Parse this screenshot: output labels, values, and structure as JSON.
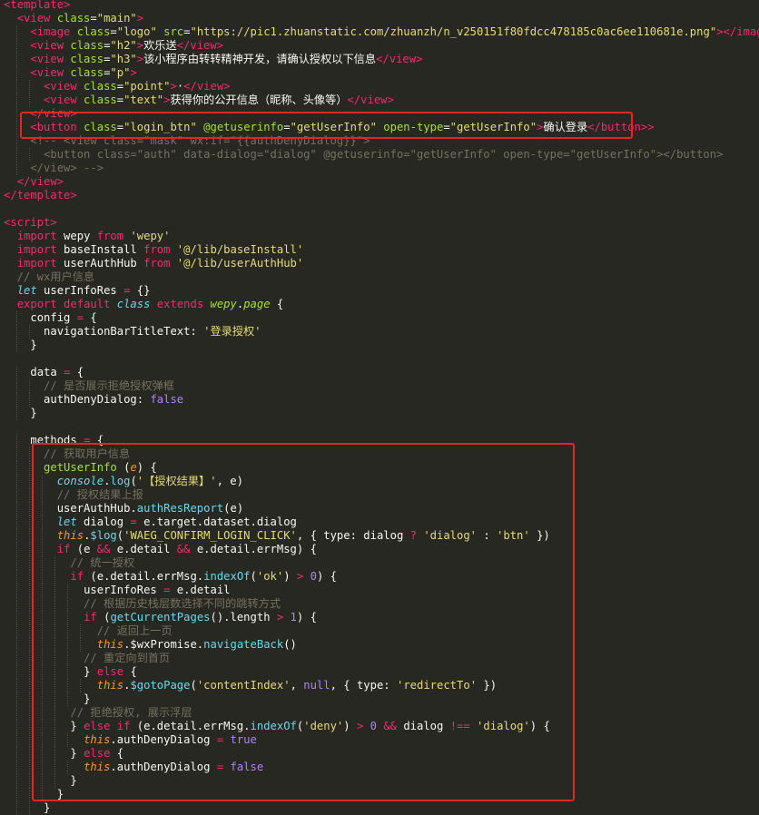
{
  "editor": {
    "language": "wepy",
    "lines": [
      [
        [
          "tag",
          "<template>"
        ]
      ],
      [
        [
          "txt",
          "  "
        ],
        [
          "tag",
          "<view"
        ],
        [
          "attr",
          " class"
        ],
        [
          "txt",
          "="
        ],
        [
          "str",
          "\"main\""
        ],
        [
          "tag",
          ">"
        ]
      ],
      [
        [
          "txt",
          "    "
        ],
        [
          "tag",
          "<image"
        ],
        [
          "attr",
          " class"
        ],
        [
          "txt",
          "="
        ],
        [
          "str",
          "\"logo\""
        ],
        [
          "attr",
          " src"
        ],
        [
          "txt",
          "="
        ],
        [
          "str",
          "\"https://pic1.zhuanstatic.com/zhuanzh/n_v250151f80fdcc478185c0ac6ee110681e.png\""
        ],
        [
          "tag",
          ">"
        ],
        [
          "tag",
          "</image>"
        ]
      ],
      [
        [
          "txt",
          "    "
        ],
        [
          "tag",
          "<view"
        ],
        [
          "attr",
          " class"
        ],
        [
          "txt",
          "="
        ],
        [
          "str",
          "\"h2\""
        ],
        [
          "tag",
          ">"
        ],
        [
          "txt",
          "欢乐送"
        ],
        [
          "tag",
          "</view>"
        ]
      ],
      [
        [
          "txt",
          "    "
        ],
        [
          "tag",
          "<view"
        ],
        [
          "attr",
          " class"
        ],
        [
          "txt",
          "="
        ],
        [
          "str",
          "\"h3\""
        ],
        [
          "tag",
          ">"
        ],
        [
          "txt",
          "该小程序由转转精神开发，请确认授权以下信息"
        ],
        [
          "tag",
          "</view>"
        ]
      ],
      [
        [
          "txt",
          "    "
        ],
        [
          "tag",
          "<view"
        ],
        [
          "attr",
          " class"
        ],
        [
          "txt",
          "="
        ],
        [
          "str",
          "\"p\""
        ],
        [
          "tag",
          ">"
        ]
      ],
      [
        [
          "txt",
          "      "
        ],
        [
          "tag",
          "<view"
        ],
        [
          "attr",
          " class"
        ],
        [
          "txt",
          "="
        ],
        [
          "str",
          "\"point\""
        ],
        [
          "tag",
          ">"
        ],
        [
          "txt",
          "·"
        ],
        [
          "tag",
          "</view>"
        ]
      ],
      [
        [
          "txt",
          "      "
        ],
        [
          "tag",
          "<view"
        ],
        [
          "attr",
          " class"
        ],
        [
          "txt",
          "="
        ],
        [
          "str",
          "\"text\""
        ],
        [
          "tag",
          ">"
        ],
        [
          "txt",
          "获得你的公开信息（昵称、头像等）"
        ],
        [
          "tag",
          "</view>"
        ]
      ],
      [
        [
          "txt",
          "    "
        ],
        [
          "tag",
          "</view>"
        ]
      ],
      [
        [
          "txt",
          "    "
        ],
        [
          "tag",
          "<button"
        ],
        [
          "attr",
          " class"
        ],
        [
          "txt",
          "="
        ],
        [
          "str",
          "\"login_btn\""
        ],
        [
          "attr",
          " @getuserinfo"
        ],
        [
          "txt",
          "="
        ],
        [
          "str",
          "\"getUserInfo\""
        ],
        [
          "attr",
          " open-type"
        ],
        [
          "txt",
          "="
        ],
        [
          "str",
          "\"getUserInfo\""
        ],
        [
          "tag",
          ">"
        ],
        [
          "txt",
          "确认登录"
        ],
        [
          "tag",
          "</button>"
        ],
        [
          "tag",
          ">"
        ]
      ],
      [
        [
          "cm",
          "    <!-- <view class=\"mask\" wx:if=\"{{authDenyDialog}}\">"
        ]
      ],
      [
        [
          "cm",
          "      <button class=\"auth\" data-dialog=\"dialog\" @getuserinfo=\"getUserInfo\" open-type=\"getUserInfo\"></button>"
        ]
      ],
      [
        [
          "cm",
          "    </view> -->"
        ]
      ],
      [
        [
          "txt",
          "  "
        ],
        [
          "tag",
          "</view>"
        ]
      ],
      [
        [
          "tag",
          "</template>"
        ]
      ],
      [
        [
          "txt",
          ""
        ]
      ],
      [
        [
          "tag",
          "<script>"
        ]
      ],
      [
        [
          "txt",
          "  "
        ],
        [
          "kw",
          "import"
        ],
        [
          "var",
          " wepy "
        ],
        [
          "kw",
          "from"
        ],
        [
          "str",
          " 'wepy'"
        ]
      ],
      [
        [
          "txt",
          "  "
        ],
        [
          "kw",
          "import"
        ],
        [
          "var",
          " baseInstall "
        ],
        [
          "kw",
          "from"
        ],
        [
          "str",
          " '@/lib/baseInstall'"
        ]
      ],
      [
        [
          "txt",
          "  "
        ],
        [
          "kw",
          "import"
        ],
        [
          "var",
          " userAuthHub "
        ],
        [
          "kw",
          "from"
        ],
        [
          "str",
          " '@/lib/userAuthHub'"
        ]
      ],
      [
        [
          "cm",
          "  // wx用户信息"
        ]
      ],
      [
        [
          "txt",
          "  "
        ],
        [
          "kwi",
          "let"
        ],
        [
          "var",
          " userInfoRes "
        ],
        [
          "op",
          "="
        ],
        [
          "var",
          " {}"
        ]
      ],
      [
        [
          "txt",
          "  "
        ],
        [
          "kw",
          "export"
        ],
        [
          "kw",
          " default"
        ],
        [
          "kwi",
          " class"
        ],
        [
          "kw",
          " extends"
        ],
        [
          "cls",
          " wepy"
        ],
        [
          "var",
          "."
        ],
        [
          "cls",
          "page"
        ],
        [
          "var",
          " {"
        ]
      ],
      [
        [
          "txt",
          "    "
        ],
        [
          "keyp",
          "config"
        ],
        [
          "var",
          " "
        ],
        [
          "op",
          "="
        ],
        [
          "var",
          " {"
        ]
      ],
      [
        [
          "txt",
          "      "
        ],
        [
          "keyp",
          "navigationBarTitleText"
        ],
        [
          "var",
          ": "
        ],
        [
          "str",
          "'登录授权'"
        ]
      ],
      [
        [
          "txt",
          "    "
        ],
        [
          "var",
          "}"
        ]
      ],
      [
        [
          "txt",
          ""
        ]
      ],
      [
        [
          "txt",
          "    "
        ],
        [
          "keyp",
          "data"
        ],
        [
          "var",
          " "
        ],
        [
          "op",
          "="
        ],
        [
          "var",
          " {"
        ]
      ],
      [
        [
          "cm",
          "      // 是否展示拒绝授权弹框"
        ]
      ],
      [
        [
          "txt",
          "      "
        ],
        [
          "keyp",
          "authDenyDialog"
        ],
        [
          "var",
          ": "
        ],
        [
          "bool",
          "false"
        ]
      ],
      [
        [
          "txt",
          "    "
        ],
        [
          "var",
          "}"
        ]
      ],
      [
        [
          "txt",
          ""
        ]
      ],
      [
        [
          "txt",
          "    "
        ],
        [
          "keyp",
          "methods"
        ],
        [
          "var",
          " "
        ],
        [
          "op",
          "="
        ],
        [
          "var",
          " {"
        ]
      ],
      [
        [
          "cm",
          "      // 获取用户信息"
        ]
      ],
      [
        [
          "txt",
          "      "
        ],
        [
          "fn",
          "getUserInfo"
        ],
        [
          "var",
          " ("
        ],
        [
          "param",
          "e"
        ],
        [
          "var",
          ") {"
        ]
      ],
      [
        [
          "txt",
          "        "
        ],
        [
          "fni",
          "console"
        ],
        [
          "var",
          "."
        ],
        [
          "mth",
          "log"
        ],
        [
          "var",
          "("
        ],
        [
          "str",
          "'【授权结果】'"
        ],
        [
          "var",
          ", e)"
        ]
      ],
      [
        [
          "cm",
          "        // 授权结果上报"
        ]
      ],
      [
        [
          "txt",
          "        "
        ],
        [
          "var",
          "userAuthHub."
        ],
        [
          "mth",
          "authResReport"
        ],
        [
          "var",
          "(e)"
        ]
      ],
      [
        [
          "txt",
          "        "
        ],
        [
          "kwi",
          "let"
        ],
        [
          "var",
          " dialog "
        ],
        [
          "op",
          "="
        ],
        [
          "var",
          " e.target.dataset.dialog"
        ]
      ],
      [
        [
          "txt",
          "        "
        ],
        [
          "this",
          "this"
        ],
        [
          "var",
          "."
        ],
        [
          "mth",
          "$log"
        ],
        [
          "var",
          "("
        ],
        [
          "str",
          "'WAEG_CONFIRM_LOGIN_CLICK'"
        ],
        [
          "var",
          ", { type: dialog "
        ],
        [
          "op",
          "?"
        ],
        [
          "str",
          " 'dialog'"
        ],
        [
          "var",
          " : "
        ],
        [
          "str",
          "'btn'"
        ],
        [
          "var",
          " })"
        ]
      ],
      [
        [
          "txt",
          "        "
        ],
        [
          "kw",
          "if"
        ],
        [
          "var",
          " (e "
        ],
        [
          "op",
          "&&"
        ],
        [
          "var",
          " e.detail "
        ],
        [
          "op",
          "&&"
        ],
        [
          "var",
          " e.detail.errMsg) {"
        ]
      ],
      [
        [
          "cm",
          "          // 统一授权"
        ]
      ],
      [
        [
          "txt",
          "          "
        ],
        [
          "kw",
          "if"
        ],
        [
          "var",
          " (e.detail.errMsg."
        ],
        [
          "mth",
          "indexOf"
        ],
        [
          "var",
          "("
        ],
        [
          "str",
          "'ok'"
        ],
        [
          "var",
          ") "
        ],
        [
          "op",
          ">"
        ],
        [
          "num",
          " 0"
        ],
        [
          "var",
          ") {"
        ]
      ],
      [
        [
          "txt",
          "            "
        ],
        [
          "var",
          "userInfoRes "
        ],
        [
          "op",
          "="
        ],
        [
          "var",
          " e.detail"
        ]
      ],
      [
        [
          "cm",
          "            // 根据历史栈层数选择不同的跳转方式"
        ]
      ],
      [
        [
          "txt",
          "            "
        ],
        [
          "kw",
          "if"
        ],
        [
          "var",
          " ("
        ],
        [
          "mth",
          "getCurrentPages"
        ],
        [
          "var",
          "().length "
        ],
        [
          "op",
          ">"
        ],
        [
          "num",
          " 1"
        ],
        [
          "var",
          ") {"
        ]
      ],
      [
        [
          "cm",
          "              // 返回上一页"
        ]
      ],
      [
        [
          "txt",
          "              "
        ],
        [
          "this",
          "this"
        ],
        [
          "var",
          ".$wxPromise."
        ],
        [
          "mth",
          "navigateBack"
        ],
        [
          "var",
          "()"
        ]
      ],
      [
        [
          "cm",
          "            // 重定向到首页"
        ]
      ],
      [
        [
          "txt",
          "            "
        ],
        [
          "var",
          "} "
        ],
        [
          "kw",
          "else"
        ],
        [
          "var",
          " {"
        ]
      ],
      [
        [
          "txt",
          "              "
        ],
        [
          "this",
          "this"
        ],
        [
          "var",
          "."
        ],
        [
          "mth",
          "$gotoPage"
        ],
        [
          "var",
          "("
        ],
        [
          "str",
          "'contentIndex'"
        ],
        [
          "var",
          ", "
        ],
        [
          "bool",
          "null"
        ],
        [
          "var",
          ", { type: "
        ],
        [
          "str",
          "'redirectTo'"
        ],
        [
          "var",
          " })"
        ]
      ],
      [
        [
          "txt",
          "            "
        ],
        [
          "var",
          "}"
        ]
      ],
      [
        [
          "cm",
          "          // 拒绝授权, 展示浮层"
        ]
      ],
      [
        [
          "txt",
          "          "
        ],
        [
          "var",
          "} "
        ],
        [
          "kw",
          "else if"
        ],
        [
          "var",
          " (e.detail.errMsg."
        ],
        [
          "mth",
          "indexOf"
        ],
        [
          "var",
          "("
        ],
        [
          "str",
          "'deny'"
        ],
        [
          "var",
          ") "
        ],
        [
          "op",
          ">"
        ],
        [
          "num",
          " 0"
        ],
        [
          "op",
          " &&"
        ],
        [
          "var",
          " dialog "
        ],
        [
          "op",
          "!=="
        ],
        [
          "str",
          " 'dialog'"
        ],
        [
          "var",
          ") {"
        ]
      ],
      [
        [
          "txt",
          "            "
        ],
        [
          "this",
          "this"
        ],
        [
          "var",
          ".authDenyDialog "
        ],
        [
          "op",
          "="
        ],
        [
          "bool",
          " true"
        ]
      ],
      [
        [
          "txt",
          "          "
        ],
        [
          "var",
          "} "
        ],
        [
          "kw",
          "else"
        ],
        [
          "var",
          " {"
        ]
      ],
      [
        [
          "txt",
          "            "
        ],
        [
          "this",
          "this"
        ],
        [
          "var",
          ".authDenyDialog "
        ],
        [
          "op",
          "="
        ],
        [
          "bool",
          " false"
        ]
      ],
      [
        [
          "txt",
          "          "
        ],
        [
          "var",
          "}"
        ]
      ],
      [
        [
          "txt",
          "        "
        ],
        [
          "var",
          "}"
        ]
      ],
      [
        [
          "txt",
          "      "
        ],
        [
          "var",
          "}"
        ]
      ]
    ]
  }
}
